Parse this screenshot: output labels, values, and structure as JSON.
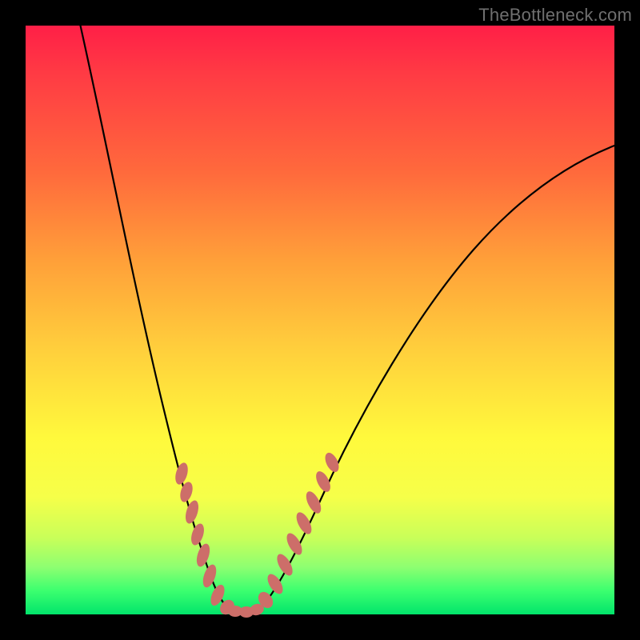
{
  "watermark": "TheBottleneck.com",
  "chart_data": {
    "type": "line",
    "title": "",
    "xlabel": "",
    "ylabel": "",
    "xlim": [
      0,
      100
    ],
    "ylim": [
      0,
      100
    ],
    "background_gradient": {
      "top_color": "#ff1f47",
      "bottom_color": "#02e46b",
      "description": "vertical rainbow gradient red->orange->yellow->green"
    },
    "series": [
      {
        "name": "bottleneck-curve",
        "description": "V-shaped curve; optimum (minimum) near x≈33, rises steeply either side",
        "x": [
          8,
          12,
          16,
          20,
          24,
          28,
          30,
          32,
          33,
          34,
          36,
          38,
          42,
          48,
          56,
          66,
          80,
          100
        ],
        "values": [
          100,
          86,
          68,
          48,
          30,
          14,
          6,
          1,
          0,
          1,
          4,
          10,
          22,
          38,
          55,
          68,
          75,
          80
        ]
      }
    ],
    "annotations": {
      "marker_color": "#cd6e69",
      "markers_description": "short segment markers clustered along both arms of the V near the trough"
    }
  }
}
